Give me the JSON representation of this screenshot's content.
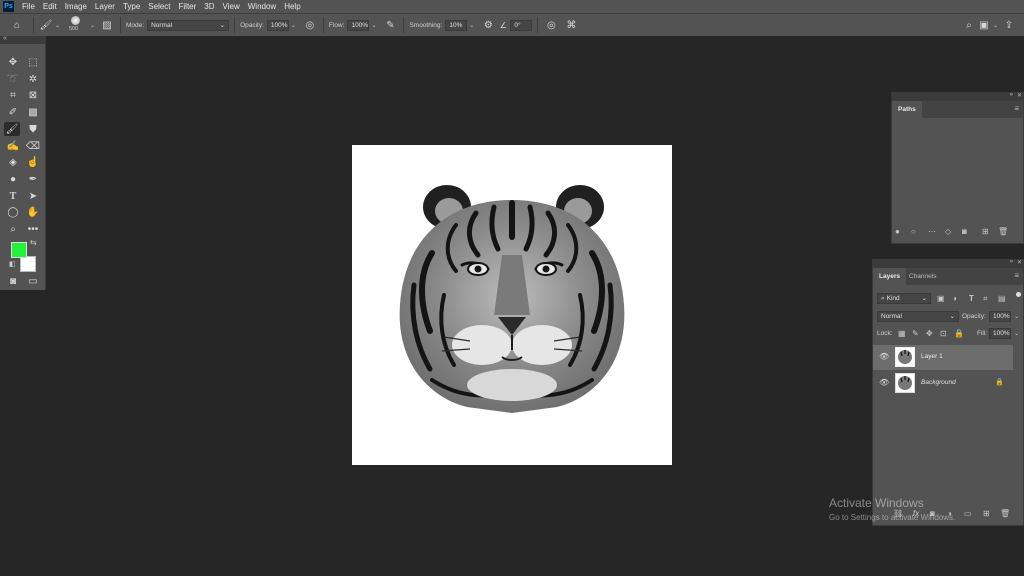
{
  "menu": [
    "File",
    "Edit",
    "Image",
    "Layer",
    "Type",
    "Select",
    "Filter",
    "3D",
    "View",
    "Window",
    "Help"
  ],
  "options_bar": {
    "brush_size": "500",
    "mode_label": "Mode:",
    "mode_value": "Normal",
    "opacity_label": "Opacity:",
    "opacity_value": "100%",
    "flow_label": "Flow:",
    "flow_value": "100%",
    "smoothing_label": "Smoothing:",
    "smoothing_value": "10%",
    "angle_value": "0°"
  },
  "colors": {
    "foreground": "#21f338",
    "background": "#ffffff",
    "ui_dark": "#262626",
    "ui_panel": "#535353",
    "selected_layer": "#6c6c6c"
  },
  "paths_panel": {
    "tab": "Paths"
  },
  "layers_panel": {
    "tabs": [
      "Layers",
      "Channels"
    ],
    "filter_kind": "Kind",
    "blend_mode": "Normal",
    "opacity_label": "Opacity:",
    "opacity_value": "100%",
    "lock_label": "Lock:",
    "fill_label": "Fill:",
    "fill_value": "100%",
    "layers": [
      {
        "name": "Layer 1",
        "selected": true,
        "locked": false
      },
      {
        "name": "Background",
        "selected": false,
        "locked": true
      }
    ]
  },
  "watermark": {
    "title": "Activate Windows",
    "subtitle": "Go to Settings to activate Windows."
  }
}
